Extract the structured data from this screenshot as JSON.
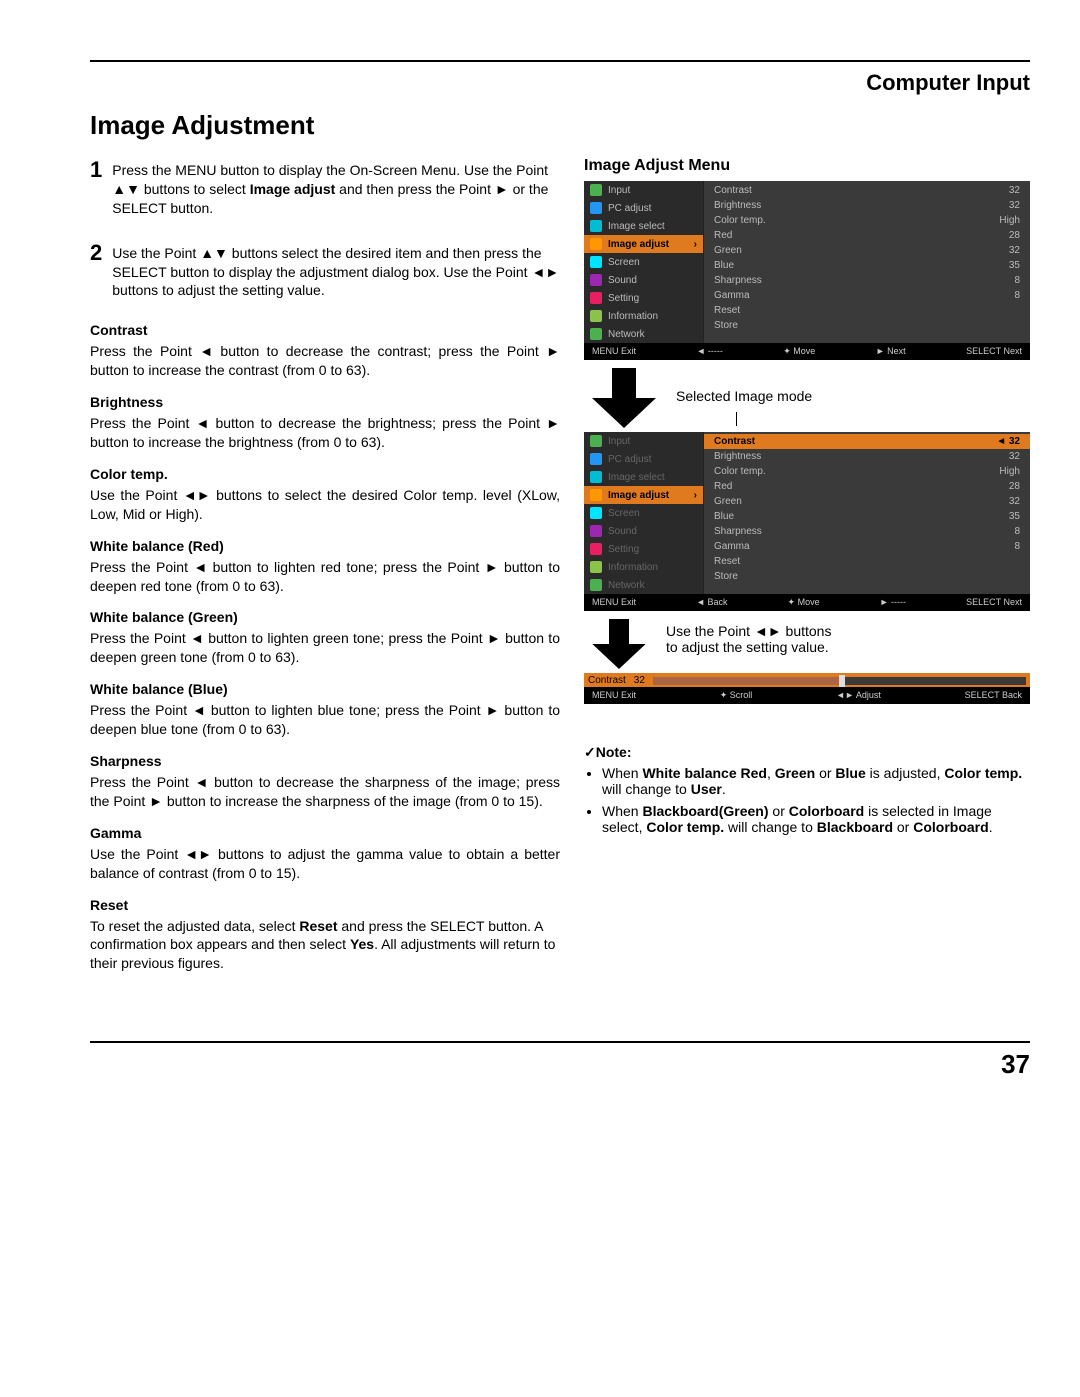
{
  "chapter_title": "Computer Input",
  "page_title": "Image Adjustment",
  "steps": [
    {
      "num": "1",
      "segments": [
        {
          "t": "Press the MENU button to display the On-Screen Menu. Use the Point ▲▼ buttons to select "
        },
        {
          "t": "Image adjust",
          "b": true
        },
        {
          "t": " and then press the Point ► or the SELECT button."
        }
      ]
    },
    {
      "num": "2",
      "segments": [
        {
          "t": "Use the Point ▲▼ buttons select the desired item and then press the SELECT button to display the adjustment dialog box. Use the Point ◄► buttons to adjust the setting value."
        }
      ]
    }
  ],
  "items": [
    {
      "name": "Contrast",
      "desc": "Press the Point ◄ button to decrease the contrast; press the Point ► button to increase the contrast (from 0 to 63)."
    },
    {
      "name": "Brightness",
      "desc": "Press the Point ◄ button to decrease the brightness; press the Point ► button to increase the brightness (from 0 to 63)."
    },
    {
      "name": "Color temp.",
      "desc": "Use the Point ◄► buttons to select the desired Color temp. level (XLow, Low, Mid or High)."
    },
    {
      "name": "White balance (Red)",
      "desc": "Press the Point ◄ button to lighten red tone; press the Point ► button to deepen red tone (from 0 to 63)."
    },
    {
      "name": "White balance (Green)",
      "desc": "Press the Point ◄ button to lighten green tone; press the Point ► button to deepen green tone (from 0 to 63)."
    },
    {
      "name": "White balance (Blue)",
      "desc": "Press the Point ◄ button to lighten blue tone; press the Point ► button to deepen blue tone (from 0 to 63)."
    },
    {
      "name": "Sharpness",
      "desc": "Press the Point ◄ button to decrease the sharpness of the image; press the Point ► button to increase the sharpness of the image (from 0 to 15)."
    },
    {
      "name": "Gamma",
      "desc": "Use the Point ◄► buttons to adjust the gamma value to obtain a better balance of contrast (from 0 to 15)."
    },
    {
      "name": "Reset",
      "desc_segments": [
        {
          "t": "To reset the adjusted data, select "
        },
        {
          "t": "Reset",
          "b": true
        },
        {
          "t": " and press the SELECT button. A confirmation box appears and then select "
        },
        {
          "t": "Yes",
          "b": true
        },
        {
          "t": ". All adjustments will return to their previous figures."
        }
      ]
    }
  ],
  "right_heading": "Image Adjust Menu",
  "osd1": {
    "menu": [
      {
        "label": "Input",
        "ic": "green"
      },
      {
        "label": "PC adjust",
        "ic": "blue"
      },
      {
        "label": "Image select",
        "ic": "teal"
      },
      {
        "label": "Image adjust",
        "ic": "orange",
        "sel": true
      },
      {
        "label": "Screen",
        "ic": "cyan"
      },
      {
        "label": "Sound",
        "ic": "purple"
      },
      {
        "label": "Setting",
        "ic": "pink"
      },
      {
        "label": "Information",
        "ic": "olive"
      },
      {
        "label": "Network",
        "ic": "green"
      }
    ],
    "props": [
      {
        "k": "Contrast",
        "v": "32"
      },
      {
        "k": "Brightness",
        "v": "32"
      },
      {
        "k": "Color temp.",
        "v": "High"
      },
      {
        "k": "Red",
        "v": "28"
      },
      {
        "k": "Green",
        "v": "32"
      },
      {
        "k": "Blue",
        "v": "35"
      },
      {
        "k": "Sharpness",
        "v": "8"
      },
      {
        "k": "Gamma",
        "v": "8"
      },
      {
        "k": "Reset",
        "v": ""
      },
      {
        "k": "Store",
        "v": ""
      }
    ],
    "bar": [
      "MENU Exit",
      "◄ -----",
      "✦ Move",
      "► Next",
      "SELECT Next"
    ]
  },
  "caption_selected": "Selected Image mode",
  "osd2": {
    "menu": [
      {
        "label": "Input",
        "ic": "green",
        "dim": true
      },
      {
        "label": "PC adjust",
        "ic": "blue",
        "dim": true
      },
      {
        "label": "Image select",
        "ic": "teal",
        "dim": true
      },
      {
        "label": "Image adjust",
        "ic": "orange",
        "sel": true
      },
      {
        "label": "Screen",
        "ic": "cyan",
        "dim": true
      },
      {
        "label": "Sound",
        "ic": "purple",
        "dim": true
      },
      {
        "label": "Setting",
        "ic": "pink",
        "dim": true
      },
      {
        "label": "Information",
        "ic": "olive",
        "dim": true
      },
      {
        "label": "Network",
        "ic": "green",
        "dim": true
      }
    ],
    "props": [
      {
        "k": "Contrast",
        "v": "◄ 32",
        "sel": true
      },
      {
        "k": "Brightness",
        "v": "32"
      },
      {
        "k": "Color temp.",
        "v": "High"
      },
      {
        "k": "Red",
        "v": "28"
      },
      {
        "k": "Green",
        "v": "32"
      },
      {
        "k": "Blue",
        "v": "35"
      },
      {
        "k": "Sharpness",
        "v": "8"
      },
      {
        "k": "Gamma",
        "v": "8"
      },
      {
        "k": "Reset",
        "v": ""
      },
      {
        "k": "Store",
        "v": ""
      }
    ],
    "bar": [
      "MENU Exit",
      "◄ Back",
      "✦ Move",
      "► -----",
      "SELECT Next"
    ]
  },
  "caption_hint": "Use the Point ◄► buttons to adjust the setting value.",
  "slider": {
    "label": "Contrast",
    "value": "32",
    "bar": [
      "MENU Exit",
      "✦ Scroll",
      "◄► Adjust",
      "SELECT Back"
    ]
  },
  "note_heading": "✓Note:",
  "notes": [
    [
      {
        "t": "When "
      },
      {
        "t": "White balance Red",
        "b": true
      },
      {
        "t": ", "
      },
      {
        "t": "Green",
        "b": true
      },
      {
        "t": " or "
      },
      {
        "t": "Blue",
        "b": true
      },
      {
        "t": " is adjusted, "
      },
      {
        "t": "Color temp.",
        "b": true
      },
      {
        "t": " will change to "
      },
      {
        "t": "User",
        "b": true
      },
      {
        "t": "."
      }
    ],
    [
      {
        "t": "When "
      },
      {
        "t": "Blackboard(Green)",
        "b": true
      },
      {
        "t": " or "
      },
      {
        "t": "Colorboard",
        "b": true
      },
      {
        "t": " is selected in Image select, "
      },
      {
        "t": "Color temp.",
        "b": true
      },
      {
        "t": " will change to "
      },
      {
        "t": "Blackboard",
        "b": true
      },
      {
        "t": " or "
      },
      {
        "t": "Colorboard",
        "b": true
      },
      {
        "t": "."
      }
    ]
  ],
  "page_number": "37"
}
